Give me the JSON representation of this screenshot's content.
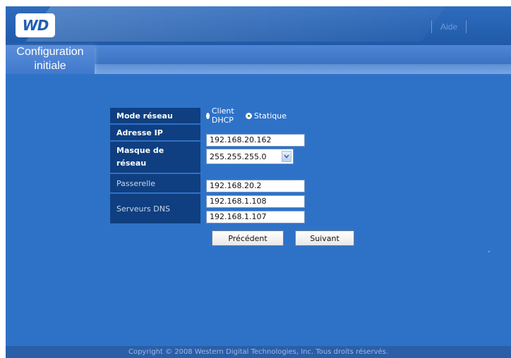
{
  "header": {
    "logo_text": "WD",
    "help_label": "Aide"
  },
  "page_tab": {
    "line1": "Configuration",
    "line2": "initiale"
  },
  "form": {
    "network_mode": {
      "label": "Mode réseau",
      "options": [
        "Client DHCP",
        "Statique"
      ],
      "selected": "Statique"
    },
    "ip_address": {
      "label": "Adresse IP",
      "value": "192.168.20.162"
    },
    "subnet_mask": {
      "label_line1": "Masque de",
      "label_line2": "réseau",
      "value": "255.255.255.0"
    },
    "gateway": {
      "label": "Passerelle",
      "value": "192.168.20.2"
    },
    "dns": {
      "label": "Serveurs DNS",
      "primary": "192.168.1.108",
      "secondary": "192.168.1.107"
    }
  },
  "buttons": {
    "previous": "Précédent",
    "next": "Suivant"
  },
  "footer": {
    "copyright": "Copyright © 2008 Western Digital Technologies, Inc. Tous droits réservés."
  },
  "colors": {
    "background": "#2e72c8",
    "label_cell": "#0f3f80",
    "header": "#205aa9"
  },
  "icons": {
    "dropdown": "chevron-down-icon",
    "radio": "radio-button"
  }
}
